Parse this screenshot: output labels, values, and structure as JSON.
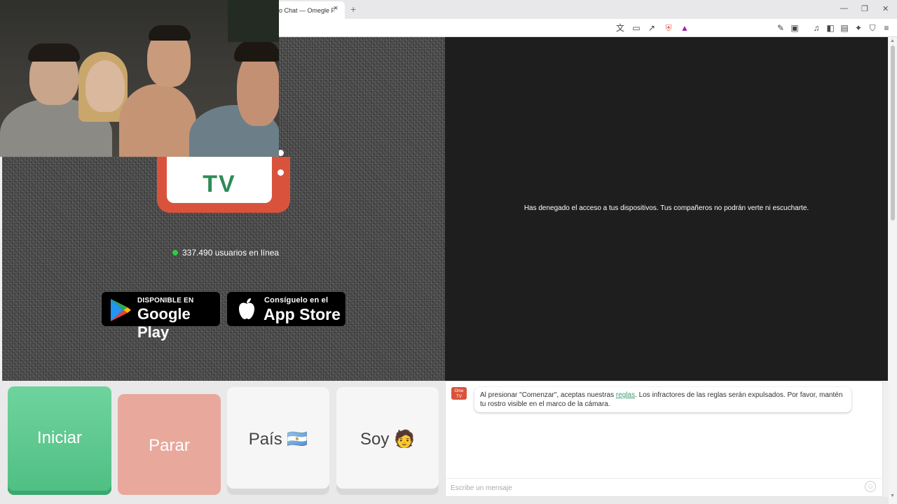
{
  "browser": {
    "tab_title": "o Chat — Omegle F",
    "tab_close": "×",
    "new_tab": "+",
    "window_controls": [
      "—",
      "❐",
      "✕"
    ],
    "toolbar_icons": [
      "translate-icon",
      "cast-icon",
      "share-icon",
      "brave-shield-icon",
      "brave-rewards-icon",
      "extensions-icon",
      "tab-search-icon",
      "media-icon",
      "sidebar-icon",
      "wallet-icon",
      "leo-icon",
      "vpn-icon",
      "menu-icon"
    ]
  },
  "page": {
    "logo_text": "TV",
    "online_count": "337.490 usuarios en línea",
    "google_play": {
      "small": "DISPONIBLE EN",
      "big": "Google Play"
    },
    "app_store": {
      "small": "Consíguelo en el",
      "big": "App Store"
    },
    "denied_message": "Has denegado el acceso a tus dispositivos. Tus compañeros no podrán verte ni escucharte."
  },
  "buttons": {
    "start": "Iniciar",
    "stop": "Parar",
    "country": "País",
    "country_flag": "🇦🇷",
    "iam": "Soy",
    "iam_emoji": "🧑"
  },
  "chat": {
    "avatar": "Ome TV",
    "msg_before": "Al presionar \"Comenzar\", aceptas nuestras ",
    "msg_link": "reglas",
    "msg_after": ". Los infractores de las reglas serán expulsados. Por favor, mantén tu rostro visible en el marco de la cámara.",
    "input_placeholder": "Escribe un mensaje",
    "emoji_icon": "☺"
  },
  "colors": {
    "brand_red": "#d9533c",
    "brand_green": "#2e8b57",
    "start_green": "#5cc98e",
    "stop_red": "#e8a89c",
    "online_dot": "#2ecc40",
    "link": "#3a9b6e"
  }
}
